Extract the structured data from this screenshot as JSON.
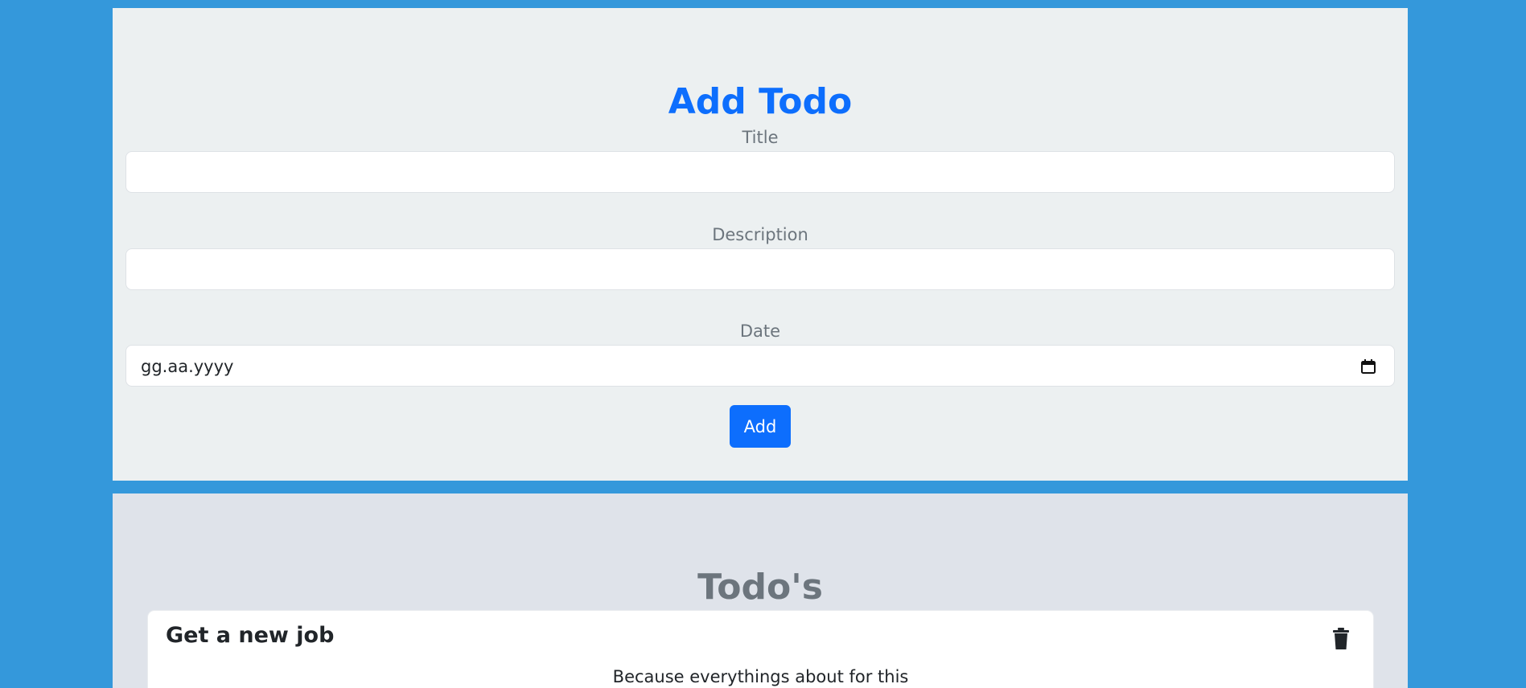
{
  "add_todo": {
    "heading": "Add Todo",
    "title_label": "Title",
    "title_value": "",
    "description_label": "Description",
    "description_value": "",
    "date_label": "Date",
    "date_placeholder": "gg.aa.yyyy",
    "add_button_label": "Add"
  },
  "todos": {
    "heading": "Todo's",
    "items": [
      {
        "title": "Get a new job",
        "description": "Because everythings about for this"
      }
    ]
  },
  "icons": {
    "calendar": "calendar-icon",
    "delete": "trash-icon"
  },
  "colors": {
    "page_background": "#3498db",
    "add_panel_background": "#ecf0f1",
    "todos_panel_background": "#dfe3ea",
    "primary": "#0d6efd",
    "muted_text": "#6c757d",
    "text": "#212529"
  }
}
